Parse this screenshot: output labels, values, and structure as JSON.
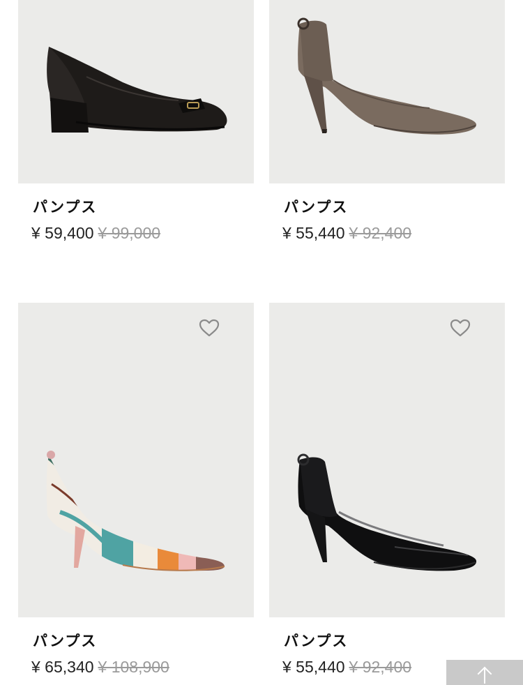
{
  "products": [
    {
      "name": "パンプス",
      "price": "¥ 59,400",
      "original_price": "¥ 99,000",
      "image": "black-leather-block-heel-pump",
      "has_wishlist": false
    },
    {
      "name": "パンプス",
      "price": "¥ 55,440",
      "original_price": "¥ 92,400",
      "image": "taupe-pointed-stiletto-pump",
      "has_wishlist": false
    },
    {
      "name": "パンプス",
      "price": "¥ 65,340",
      "original_price": "¥ 108,900",
      "image": "multicolor-print-stiletto-pump",
      "has_wishlist": true
    },
    {
      "name": "パンプス",
      "price": "¥ 55,440",
      "original_price": "¥ 92,400",
      "image": "black-patent-stiletto-pump",
      "has_wishlist": true
    }
  ],
  "icons": {
    "wishlist": "heart-icon",
    "back_to_top": "arrow-up-icon"
  },
  "colors": {
    "image_background": "#ebebe9",
    "price_original": "#9a9a9a",
    "top_button": "#c9c9c9"
  }
}
